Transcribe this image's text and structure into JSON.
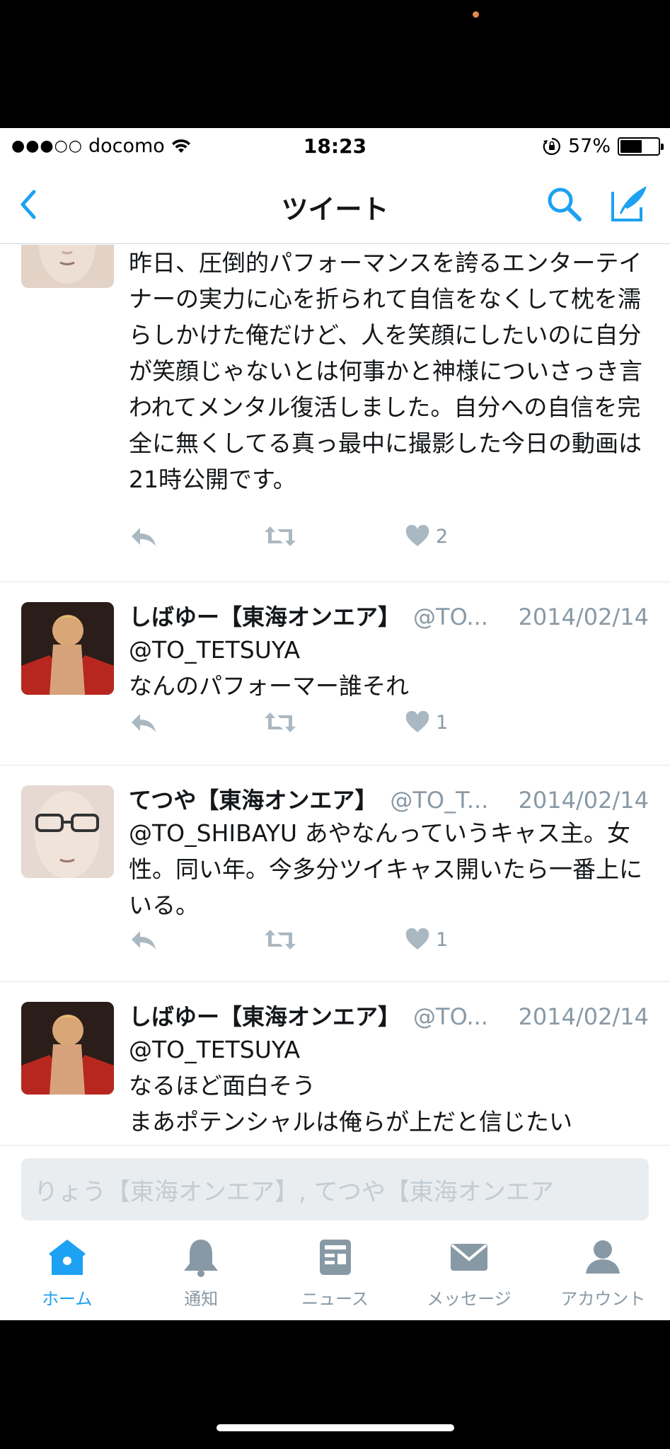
{
  "status_bar": {
    "signal": "●●●○○",
    "carrier": "docomo",
    "time": "18:23",
    "battery_percent": "57%",
    "battery_level": 0.57
  },
  "nav": {
    "title": "ツイート",
    "back_icon": "chevron-left-icon",
    "search_icon": "search-icon",
    "compose_icon": "compose-icon"
  },
  "tweets": [
    {
      "author": "",
      "handle": "",
      "date": "",
      "text": "昨日、圧倒的パフォーマンスを誇るエンターテイナーの実力に心を折られて自信をなくして枕を濡らしかけた俺だけど、人を笑顔にしたいのに自分が笑顔じゃないとは何事かと神様についさっき言われてメンタル復活しました。自分への自信を完全に無くしてる真っ最中に撮影した今日の動画は21時公開です。",
      "likes": "2"
    },
    {
      "author": "しばゆー【東海オンエア】",
      "handle": "@TO...",
      "date": "2014/02/14",
      "text_lines": [
        "@TO_TETSUYA",
        "なんのパフォーマー誰それ"
      ],
      "likes": "1"
    },
    {
      "author": "てつや【東海オンエア】",
      "handle": "@TO_T...",
      "date": "2014/02/14",
      "text": "@TO_SHIBAYU あやなんっていうキャス主。女性。同い年。今多分ツイキャス開いたら一番上にいる。",
      "likes": "1"
    },
    {
      "author": "しばゆー【東海オンエア】",
      "handle": "@TO...",
      "date": "2014/02/14",
      "text_lines": [
        "@TO_TETSUYA",
        "なるほど面白そう",
        "まあポテンシャルは俺らが上だと信じたい"
      ]
    }
  ],
  "reply": {
    "placeholder": "りょう【東海オンエア】, てつや【東海オンエア"
  },
  "tabs": [
    {
      "label": "ホーム",
      "icon": "home-icon",
      "active": true
    },
    {
      "label": "通知",
      "icon": "bell-icon",
      "active": false
    },
    {
      "label": "ニュース",
      "icon": "news-icon",
      "active": false
    },
    {
      "label": "メッセージ",
      "icon": "envelope-icon",
      "active": false
    },
    {
      "label": "アカウント",
      "icon": "person-icon",
      "active": false
    }
  ],
  "colors": {
    "accent": "#1da1f2",
    "muted": "#8899a6",
    "text": "#14171a",
    "divider": "#e1e8ed"
  }
}
